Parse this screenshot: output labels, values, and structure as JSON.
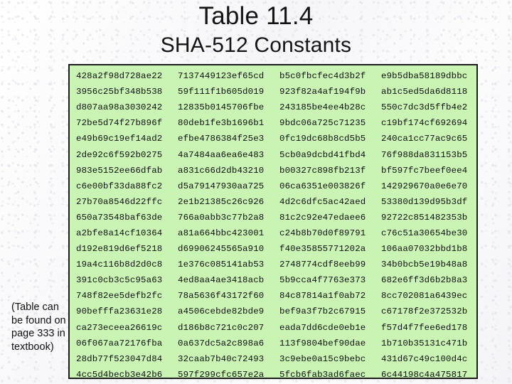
{
  "slide": {
    "title": "Table 11.4",
    "subtitle": "SHA-512 Constants",
    "caption": "(Table can be found on page 333 in textbook)",
    "colors": {
      "table_background": "#c9f4b4",
      "table_border": "#1b1b1b",
      "text": "#101010",
      "slide_background": "#fbfbfc"
    }
  },
  "constants_table": {
    "columns": 4,
    "rows": 20,
    "total_constants": 80,
    "values": [
      [
        "428a2f98d728ae22",
        "7137449123ef65cd",
        "b5c0fbcfec4d3b2f",
        "e9b5dba58189dbbc"
      ],
      [
        "3956c25bf348b538",
        "59f111f1b605d019",
        "923f82a4af194f9b",
        "ab1c5ed5da6d8118"
      ],
      [
        "d807aa98a3030242",
        "12835b0145706fbe",
        "243185be4ee4b28c",
        "550c7dc3d5ffb4e2"
      ],
      [
        "72be5d74f27b896f",
        "80deb1fe3b1696b1",
        "9bdc06a725c71235",
        "c19bf174cf692694"
      ],
      [
        "e49b69c19ef14ad2",
        "efbe4786384f25e3",
        "0fc19dc68b8cd5b5",
        "240ca1cc77ac9c65"
      ],
      [
        "2de92c6f592b0275",
        "4a7484aa6ea6e483",
        "5cb0a9dcbd41fbd4",
        "76f988da831153b5"
      ],
      [
        "983e5152ee66dfab",
        "a831c66d2db43210",
        "b00327c898fb213f",
        "bf597fc7beef0ee4"
      ],
      [
        "c6e00bf33da88fc2",
        "d5a79147930aa725",
        "06ca6351e003826f",
        "142929670a0e6e70"
      ],
      [
        "27b70a8546d22ffc",
        "2e1b21385c26c926",
        "4d2c6dfc5ac42aed",
        "53380d139d95b3df"
      ],
      [
        "650a73548baf63de",
        "766a0abb3c77b2a8",
        "81c2c92e47edaee6",
        "92722c851482353b"
      ],
      [
        "a2bfe8a14cf10364",
        "a81a664bbc423001",
        "c24b8b70d0f89791",
        "c76c51a30654be30"
      ],
      [
        "d192e819d6ef5218",
        "d69906245565a910",
        "f40e35855771202a",
        "106aa07032bbd1b8"
      ],
      [
        "19a4c116b8d2d0c8",
        "1e376c085141ab53",
        "2748774cdf8eeb99",
        "34b0bcb5e19b48a8"
      ],
      [
        "391c0cb3c5c95a63",
        "4ed8aa4ae3418acb",
        "5b9cca4f7763e373",
        "682e6ff3d6b2b8a3"
      ],
      [
        "748f82ee5defb2fc",
        "78a5636f43172f60",
        "84c87814a1f0ab72",
        "8cc702081a6439ec"
      ],
      [
        "90befffa23631e28",
        "a4506cebde82bde9",
        "bef9a3f7b2c67915",
        "c67178f2e372532b"
      ],
      [
        "ca273eceea26619c",
        "d186b8c721c0c207",
        "eada7dd6cde0eb1e",
        "f57d4f7fee6ed178"
      ],
      [
        "06f067aa72176fba",
        "0a637dc5a2c898a6",
        "113f9804bef90dae",
        "1b710b35131c471b"
      ],
      [
        "28db77f523047d84",
        "32caab7b40c72493",
        "3c9ebe0a15c9bebc",
        "431d67c49c100d4c"
      ],
      [
        "4cc5d4becb3e42b6",
        "597f299cfc657e2a",
        "5fcb6fab3ad6faec",
        "6c44198c4a475817"
      ]
    ]
  }
}
